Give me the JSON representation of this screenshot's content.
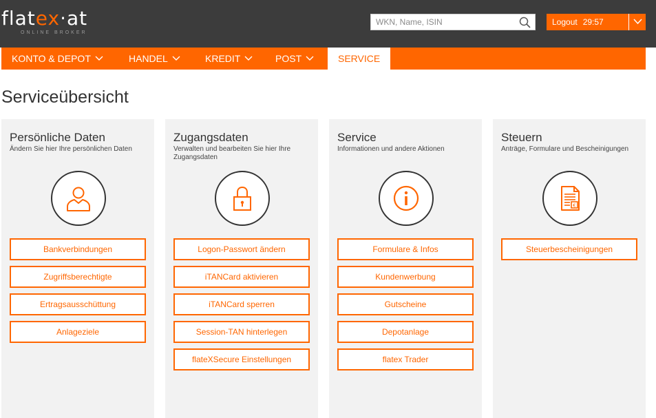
{
  "brand": {
    "logo_prefix": "flat",
    "logo_accent": "ex",
    "logo_suffix": "·at",
    "tagline": "ONLINE BROKER"
  },
  "search": {
    "placeholder": "WKN, Name, ISIN"
  },
  "logout": {
    "label": "Logout",
    "timer": "29:57"
  },
  "nav": {
    "items": [
      {
        "label": "KONTO & DEPOT"
      },
      {
        "label": "HANDEL"
      },
      {
        "label": "KREDIT"
      },
      {
        "label": "POST"
      },
      {
        "label": "SERVICE"
      }
    ]
  },
  "page": {
    "title": "Serviceübersicht"
  },
  "cards": [
    {
      "title": "Persönliche Daten",
      "description": "Ändern Sie hier Ihre persönlichen Daten",
      "icon": "person-icon",
      "buttons": [
        "Bankverbindungen",
        "Zugriffsberechtigte",
        "Ertragsausschüttung",
        "Anlageziele"
      ]
    },
    {
      "title": "Zugangsdaten",
      "description": "Verwalten und bearbeiten Sie hier Ihre Zugangsdaten",
      "icon": "lock-icon",
      "buttons": [
        "Logon-Passwort ändern",
        "iTANCard aktivieren",
        "iTANCard sperren",
        "Session-TAN hinterlegen",
        "flateXSecure Einstellungen"
      ]
    },
    {
      "title": "Service",
      "description": "Informationen und andere Aktionen",
      "icon": "info-icon",
      "buttons": [
        "Formulare & Infos",
        "Kundenwerbung",
        "Gutscheine",
        "Depotanlage",
        "flatex Trader"
      ]
    },
    {
      "title": "Steuern",
      "description": "Anträge, Formulare und Bescheinigungen",
      "icon": "tax-document-icon",
      "buttons": [
        "Steuerbescheinigungen"
      ]
    }
  ],
  "colors": {
    "accent": "#ff6600",
    "header_bg": "#3c3c3c",
    "card_bg": "#f2f2f2"
  }
}
